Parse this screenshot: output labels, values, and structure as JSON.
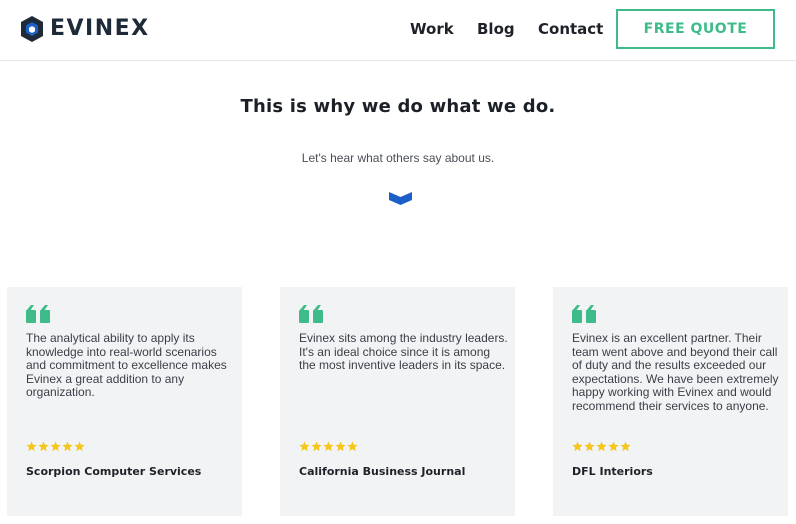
{
  "header": {
    "logo_text": "EVINEX",
    "nav": [
      {
        "label": "Work"
      },
      {
        "label": "Blog"
      },
      {
        "label": "Contact"
      }
    ],
    "cta_label": "FREE QUOTE"
  },
  "hero": {
    "title": "This is why we do what we do.",
    "subtitle": "Let's hear what others say about us."
  },
  "testimonials": [
    {
      "text": "The analytical ability to apply its knowledge into real-world scenarios and commitment to excellence makes Evinex a great addition to any organization.",
      "rating": 5,
      "author": "Scorpion Computer Services"
    },
    {
      "text": "Evinex sits among the industry leaders. It's an ideal choice since it is among the most inventive leaders in its space.",
      "rating": 5,
      "author": "California Business Journal"
    },
    {
      "text": "Evinex is an excellent partner. Their team went above and beyond their call of duty and the results exceeded our expectations. We have been extremely happy working with Evinex and would recommend their services to anyone.",
      "rating": 5,
      "author": "DFL Interiors"
    }
  ],
  "colors": {
    "brand_blue": "#1d5fc9",
    "accent_green": "#3ebb89",
    "star_yellow": "#f5c518",
    "card_bg": "#f2f3f5"
  },
  "icons": {
    "logo": "hexagon-logo-icon",
    "scroll": "chevron-down-icon",
    "quote": "quote-icon",
    "star": "star-icon"
  }
}
